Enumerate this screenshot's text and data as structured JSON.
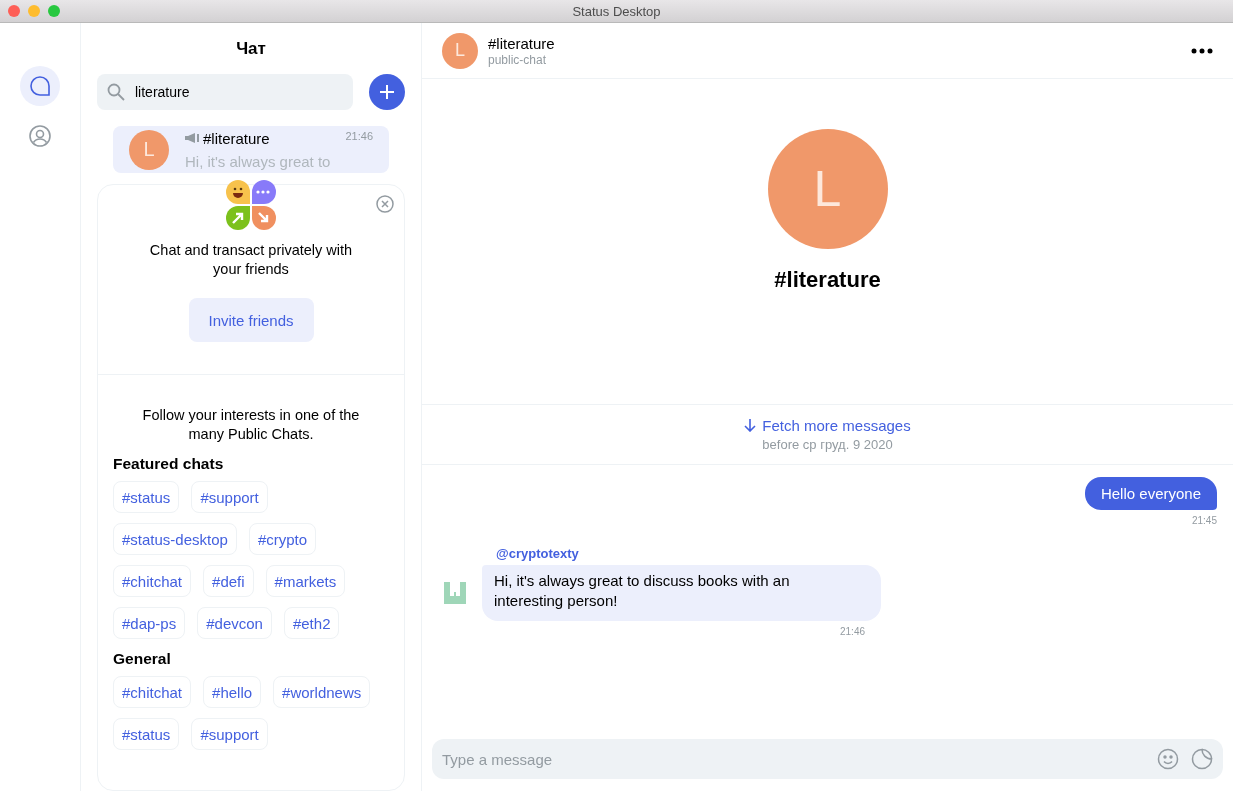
{
  "window": {
    "title": "Status Desktop"
  },
  "nav": [
    {
      "kind": "chat",
      "selected": true
    },
    {
      "kind": "profile",
      "selected": false
    }
  ],
  "chat_list": {
    "title": "Чат",
    "search": {
      "value": "literature"
    },
    "chats": [
      {
        "letter": "L",
        "name": "#literature",
        "time": "21:46",
        "preview": "Hi, it's always great to",
        "selected": true
      }
    ]
  },
  "welcome_card": {
    "message": "Chat and transact privately with your friends",
    "invite_button": "Invite friends",
    "intro": "Follow your interests in one of the many Public Chats.",
    "sections": [
      {
        "title": "Featured chats",
        "tags": [
          "#status",
          "#support",
          "#status-desktop",
          "#crypto",
          "#chitchat",
          "#defi",
          "#markets",
          "#dap-ps",
          "#devcon",
          "#eth2"
        ]
      },
      {
        "title": "General",
        "tags": [
          "#chitchat",
          "#hello",
          "#worldnews",
          "#status",
          "#support"
        ]
      }
    ]
  },
  "chat_header": {
    "letter": "L",
    "name": "#literature",
    "subtitle": "public-chat"
  },
  "hero": {
    "letter": "L",
    "name": "#literature"
  },
  "fetch_more": {
    "label": "Fetch more messages",
    "before": "before ср груд. 9 2020"
  },
  "messages": [
    {
      "kind": "outgoing",
      "text": "Hello everyone",
      "time": "21:45"
    },
    {
      "kind": "incoming",
      "author": "@cryptotexty",
      "text": "Hi, it's always great to discuss books with an interesting person!",
      "time": "21:46"
    }
  ],
  "composer": {
    "placeholder": "Type a message"
  }
}
